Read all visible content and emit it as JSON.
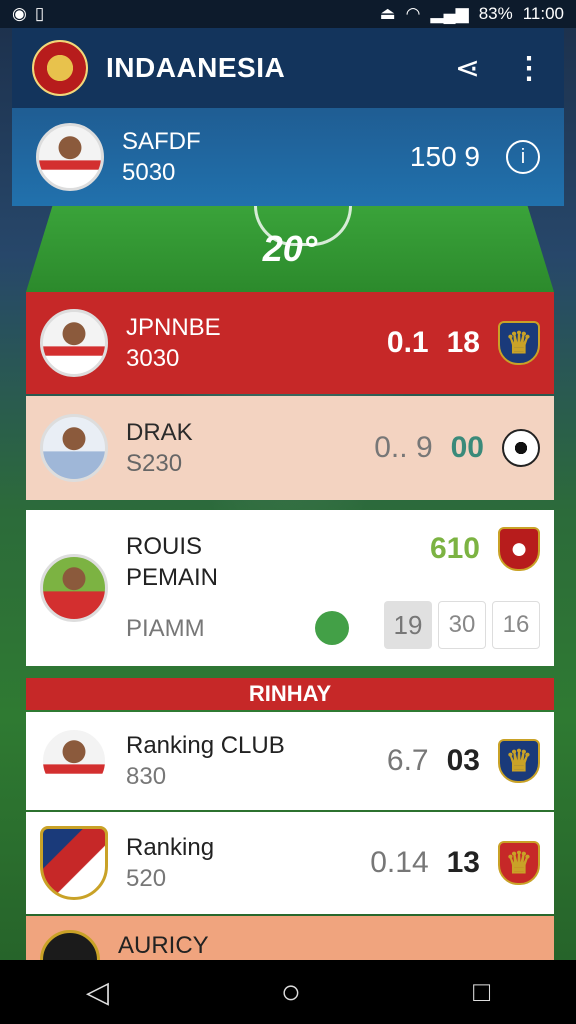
{
  "status": {
    "battery": "83%",
    "time": "11:00"
  },
  "appbar": {
    "title": "INDAANESIA"
  },
  "hero": {
    "name": "SAFDF",
    "value": "5030",
    "score": "150 9"
  },
  "pitch": {
    "label": "20°"
  },
  "rows": [
    {
      "name": "JPNNBE",
      "sub": "3030",
      "s1": "0.1",
      "s2": "18"
    },
    {
      "name": "DRAK",
      "sub": "S230",
      "s1": "0.. 9",
      "s2": "00"
    },
    {
      "name1": "ROUIS",
      "name2": "PEMAIN",
      "score": "610",
      "sub": "PIAMM",
      "b1": "19",
      "b2": "30",
      "b3": "16"
    }
  ],
  "section": {
    "title": "RINHAY"
  },
  "ranking": [
    {
      "name": "Ranking CLUB",
      "sub": "830",
      "s1": "6.7",
      "s2": "03"
    },
    {
      "name": "Ranking",
      "sub": "520",
      "s1": "0.14",
      "s2": "13"
    },
    {
      "name": "AURICY"
    }
  ],
  "colors": {
    "primary": "#13345c",
    "accent": "#c62828",
    "green": "#7cb342"
  }
}
